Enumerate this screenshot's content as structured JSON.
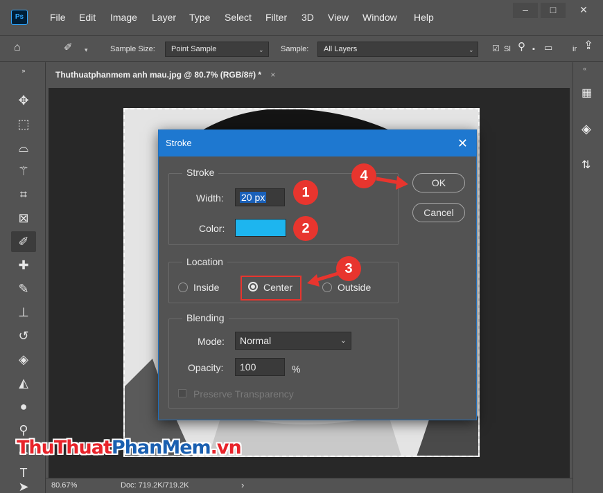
{
  "menubar": {
    "logo": "Ps",
    "items": [
      "File",
      "Edit",
      "Image",
      "Layer",
      "Type",
      "Select",
      "Filter",
      "3D",
      "View",
      "Window",
      "Help"
    ],
    "window_buttons": {
      "minimize": "–",
      "restore": "□",
      "close": "✕"
    }
  },
  "options": {
    "sample_size_label": "Sample Size:",
    "sample_size_value": "Point Sample",
    "sample_label": "Sample:",
    "sample_value": "All Layers",
    "show_ring_label": "Sl",
    "trailing_label": "ir"
  },
  "document_tab": {
    "title": "Thuthuatphanmem anh mau.jpg @ 80.7% (RGB/8#) *",
    "close": "×"
  },
  "statusbar": {
    "zoom": "80.67%",
    "doc": "Doc: 719.2K/719.2K",
    "arrow": "›"
  },
  "dialog": {
    "title": "Stroke",
    "close": "✕",
    "stroke_group": "Stroke",
    "width_label": "Width:",
    "width_value": "20 px",
    "color_label": "Color:",
    "color_value": "#1db5ef",
    "location_group": "Location",
    "location_options": [
      "Inside",
      "Center",
      "Outside"
    ],
    "location_selected": "Center",
    "blending_group": "Blending",
    "mode_label": "Mode:",
    "mode_value": "Normal",
    "opacity_label": "Opacity:",
    "opacity_value": "100",
    "opacity_unit": "%",
    "preserve_label": "Preserve Transparency",
    "ok_label": "OK",
    "cancel_label": "Cancel"
  },
  "annotations": {
    "step1": "1",
    "step2": "2",
    "step3": "3",
    "step4": "4",
    "color": "#e8352e"
  },
  "watermark": {
    "part1": "Thu",
    "part2": "Thuat",
    "part3": "Phan",
    "part4": "Mem",
    ".vn": ".vn",
    "color_red": "#e8232a",
    "color_blue": "#1a5fb0"
  },
  "colors": {
    "dialog_title_bg": "#1e78d0",
    "panel_bg": "#535353",
    "canvas_bg": "#282828"
  }
}
